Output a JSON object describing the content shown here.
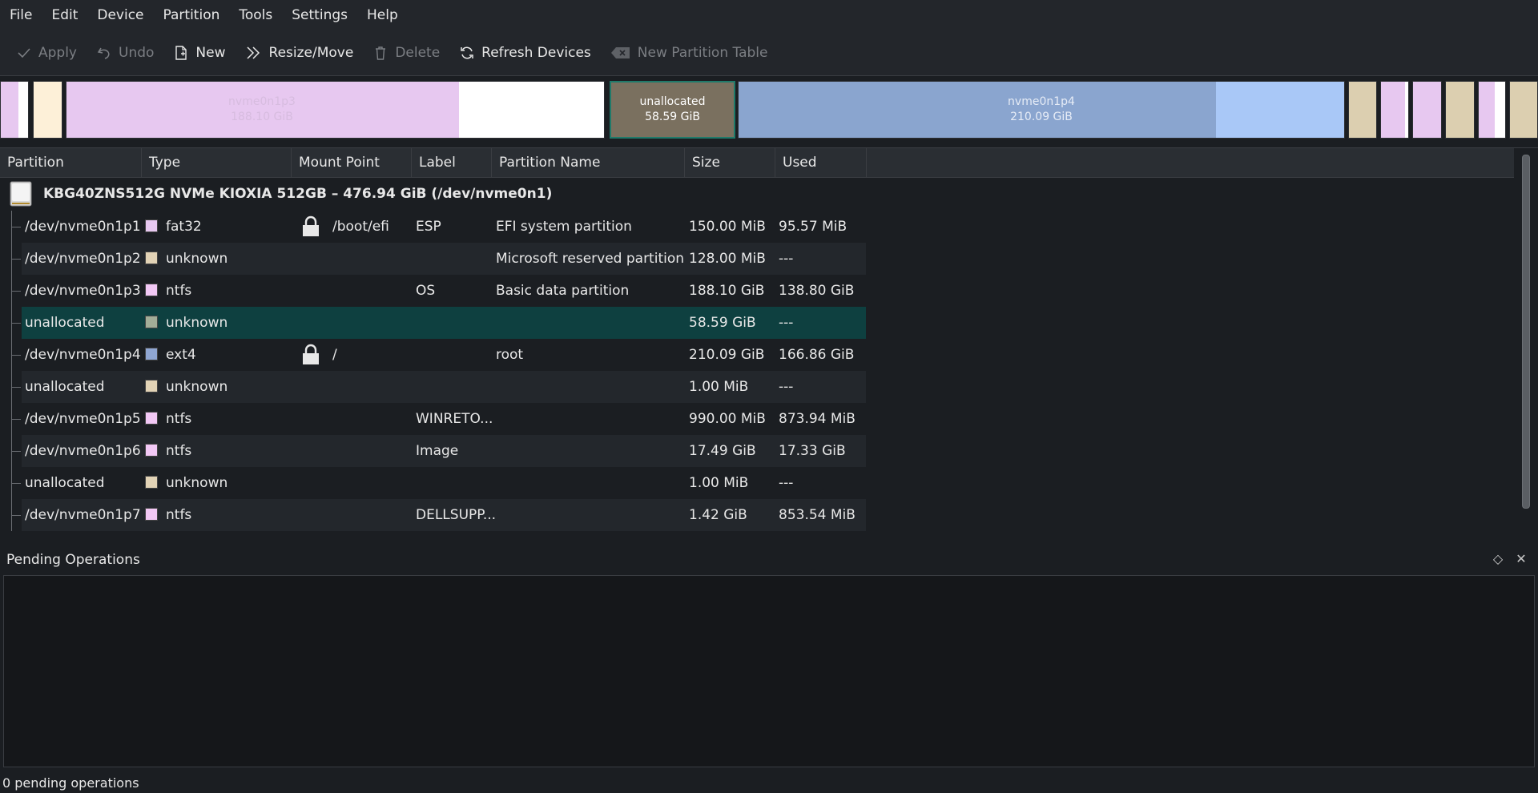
{
  "menubar": {
    "items": [
      "File",
      "Edit",
      "Device",
      "Partition",
      "Tools",
      "Settings",
      "Help"
    ]
  },
  "toolbar": {
    "apply": "Apply",
    "undo": "Undo",
    "new": "New",
    "resize_move": "Resize/Move",
    "delete": "Delete",
    "refresh": "Refresh Devices",
    "new_partition_table": "New Partition Table"
  },
  "partition_bar": {
    "p3": {
      "name": "nvme0n1p3",
      "size": "188.10 GiB"
    },
    "unallocated": {
      "name": "unallocated",
      "size": "58.59 GiB"
    },
    "p4": {
      "name": "nvme0n1p4",
      "size": "210.09 GiB"
    }
  },
  "table": {
    "headers": [
      "Partition",
      "Type",
      "Mount Point",
      "Label",
      "Partition Name",
      "Size",
      "Used"
    ],
    "device": "KBG40ZNS512G NVMe KIOXIA 512GB – 476.94 GiB (/dev/nvme0n1)",
    "rows": [
      {
        "partition": "/dev/nvme0n1p1",
        "type": "fat32",
        "color": "#e7c8f0",
        "mount": "/boot/efi",
        "lock": true,
        "label": "ESP",
        "name": "EFI system partition",
        "size": "150.00 MiB",
        "used": "95.57 MiB"
      },
      {
        "partition": "/dev/nvme0n1p2",
        "type": "unknown",
        "color": "#e2d3b6",
        "mount": "",
        "lock": false,
        "label": "",
        "name": "Microsoft reserved partition",
        "size": "128.00 MiB",
        "used": "---"
      },
      {
        "partition": "/dev/nvme0n1p3",
        "type": "ntfs",
        "color": "#f2c8f5",
        "mount": "",
        "lock": false,
        "label": "OS",
        "name": "Basic data partition",
        "size": "188.10 GiB",
        "used": "138.80 GiB"
      },
      {
        "partition": "unallocated",
        "type": "unknown",
        "color": "#a3ad98",
        "mount": "",
        "lock": false,
        "label": "",
        "name": "",
        "size": "58.59 GiB",
        "used": "---"
      },
      {
        "partition": "/dev/nvme0n1p4",
        "type": "ext4",
        "color": "#8fa6d2",
        "mount": "/",
        "lock": true,
        "label": "",
        "name": "root",
        "size": "210.09 GiB",
        "used": "166.86 GiB"
      },
      {
        "partition": "unallocated",
        "type": "unknown",
        "color": "#e2d3b6",
        "mount": "",
        "lock": false,
        "label": "",
        "name": "",
        "size": "1.00 MiB",
        "used": "---"
      },
      {
        "partition": "/dev/nvme0n1p5",
        "type": "ntfs",
        "color": "#f2c8f5",
        "mount": "",
        "lock": false,
        "label": "WINRETO...",
        "name": "",
        "size": "990.00 MiB",
        "used": "873.94 MiB"
      },
      {
        "partition": "/dev/nvme0n1p6",
        "type": "ntfs",
        "color": "#f2c8f5",
        "mount": "",
        "lock": false,
        "label": "Image",
        "name": "",
        "size": "17.49 GiB",
        "used": "17.33 GiB"
      },
      {
        "partition": "unallocated",
        "type": "unknown",
        "color": "#e2d3b6",
        "mount": "",
        "lock": false,
        "label": "",
        "name": "",
        "size": "1.00 MiB",
        "used": "---"
      },
      {
        "partition": "/dev/nvme0n1p7",
        "type": "ntfs",
        "color": "#f2c8f5",
        "mount": "",
        "lock": false,
        "label": "DELLSUPP...",
        "name": "",
        "size": "1.42 GiB",
        "used": "853.54 MiB"
      }
    ]
  },
  "pending": {
    "title": "Pending Operations"
  },
  "status": {
    "text": "0 pending operations"
  },
  "colors": {
    "selection": "#0e4040",
    "background": "#1b1e22"
  }
}
